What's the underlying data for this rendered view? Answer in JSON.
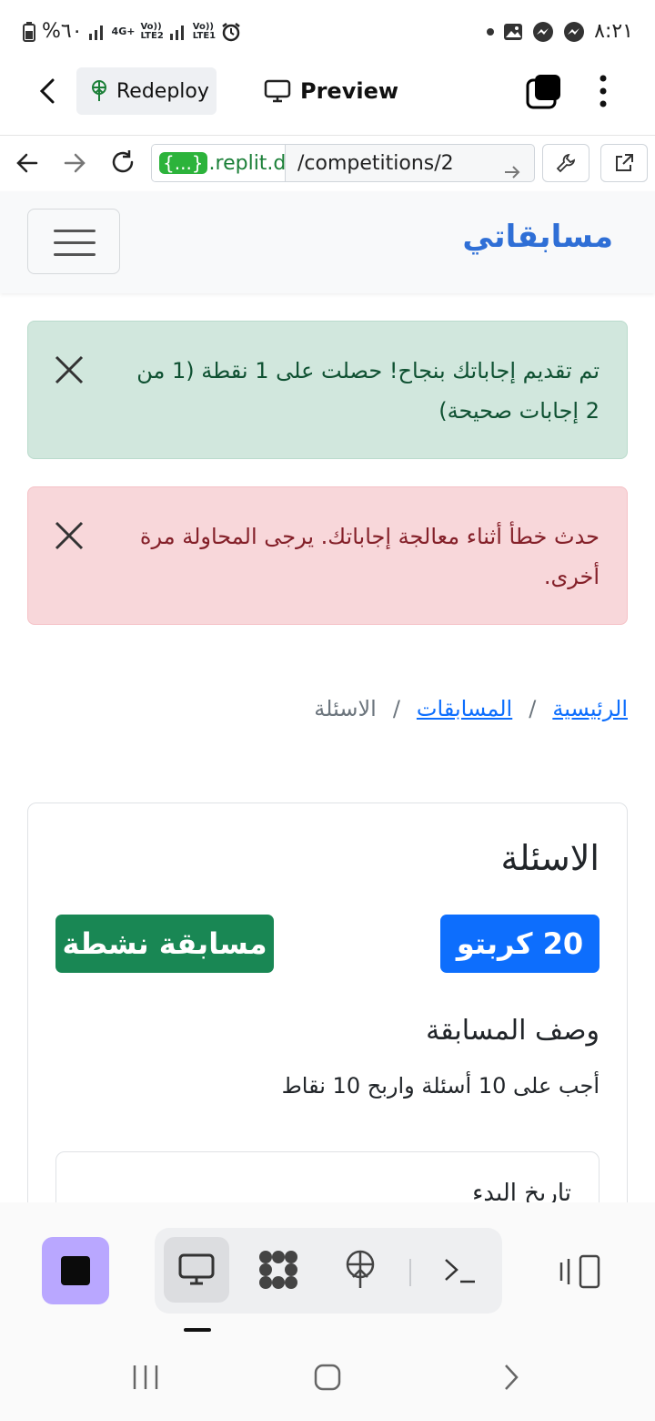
{
  "status_bar": {
    "left_text": "%٦٠",
    "network_1": "4G+",
    "volte_2": "Vo))\nLTE2",
    "volte_1": "Vo))\nLTE1",
    "time": "٨:٢١"
  },
  "replit_bar": {
    "redeploy_label": "Redeploy",
    "preview_label": "Preview"
  },
  "url_bar": {
    "domain_pill": "{...}",
    "domain": ".replit.de",
    "path": "/competitions/2"
  },
  "site": {
    "brand": "مسابقاتي"
  },
  "alerts": {
    "success": "تم تقديم إجاباتك بنجاح! حصلت على 1 نقطة (1 من 2 إجابات صحيحة)",
    "error": "حدث خطأ أثناء معالجة إجاباتك. يرجى المحاولة مرة أخرى."
  },
  "breadcrumb": {
    "home": "الرئيسية",
    "competitions": "المسابقات",
    "current": "الاسئلة",
    "separator": "/"
  },
  "card": {
    "title": "الاسئلة",
    "reward_badge": "20 كربتو",
    "status_badge": "مسابقة نشطة",
    "description_title": "وصف المسابقة",
    "description_text": "أجب على 10 أسئلة واربح 10 نقاط",
    "start_date_label": "تاريخ البدء"
  },
  "colors": {
    "brand": "#2f6fd6",
    "reward_badge": "#0d6efd",
    "status_badge": "#198754",
    "stop_button": "#b9a7ff"
  },
  "icons": {
    "dock": [
      "stop-icon",
      "desktop-preview-icon",
      "workspace-grid-icon",
      "deploy-icon",
      "shell-icon",
      "split-view-icon"
    ],
    "system_nav": [
      "recent-apps-icon",
      "home-icon",
      "back-icon"
    ]
  }
}
